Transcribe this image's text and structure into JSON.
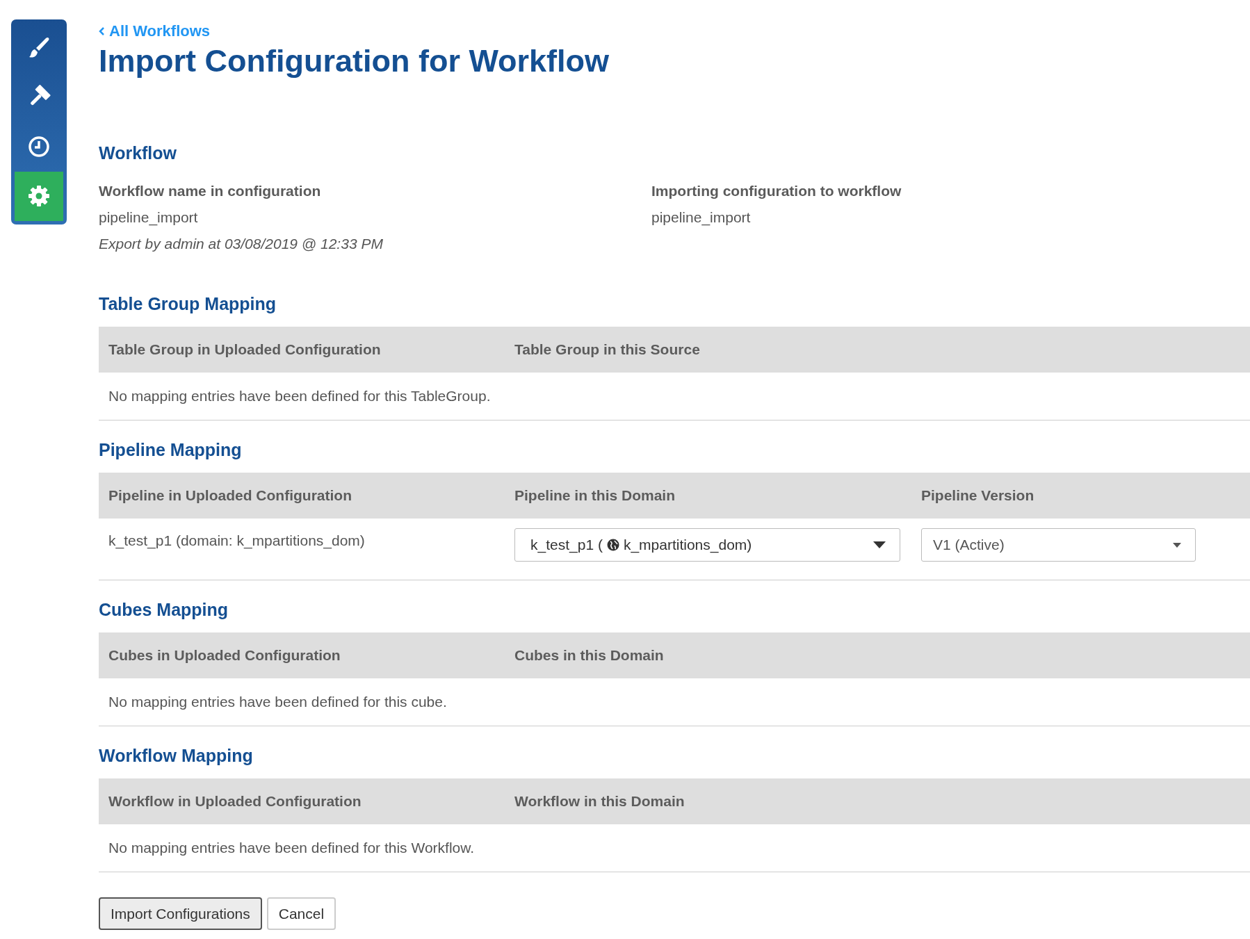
{
  "sidebar": {
    "items": [
      {
        "kind": "brush",
        "selected": false
      },
      {
        "kind": "gavel",
        "selected": false
      },
      {
        "kind": "clock",
        "selected": false
      },
      {
        "kind": "gear",
        "selected": true
      }
    ]
  },
  "back_link": "All Workflows",
  "title": "Import Configuration for Workflow",
  "workflow": {
    "heading": "Workflow",
    "left": {
      "label": "Workflow name in configuration",
      "value": "pipeline_import",
      "note": "Export by admin at 03/08/2019 @ 12:33 PM"
    },
    "right": {
      "label": "Importing configuration to workflow",
      "value": "pipeline_import"
    }
  },
  "mappings": [
    {
      "heading": "Table Group Mapping",
      "columns": [
        "Table Group in Uploaded Configuration",
        "Table Group in this Source"
      ],
      "empty_message": "No mapping entries have been defined for this TableGroup."
    },
    {
      "heading": "Pipeline Mapping",
      "columns": [
        "Pipeline in Uploaded Configuration",
        "Pipeline in this Domain",
        "Pipeline Version"
      ],
      "rows": [
        [
          {
            "kind": "text",
            "text": "k_test_p1 (domain: k_mpartitions_dom)"
          },
          {
            "kind": "domain-select",
            "prefix": "k_test_p1 (",
            "domain": "k_mpartitions_dom)"
          },
          {
            "kind": "select",
            "value": "V1 (Active)"
          }
        ]
      ]
    },
    {
      "heading": "Cubes Mapping",
      "columns": [
        "Cubes in Uploaded Configuration",
        "Cubes in this Domain"
      ],
      "empty_message": "No mapping entries have been defined for this cube."
    },
    {
      "heading": "Workflow Mapping",
      "columns": [
        "Workflow in Uploaded Configuration",
        "Workflow in this Domain"
      ],
      "empty_message": "No mapping entries have been defined for this Workflow."
    }
  ],
  "buttons": [
    {
      "label": "Import Configurations",
      "kind": "primary"
    },
    {
      "label": "Cancel",
      "kind": "secondary"
    }
  ]
}
